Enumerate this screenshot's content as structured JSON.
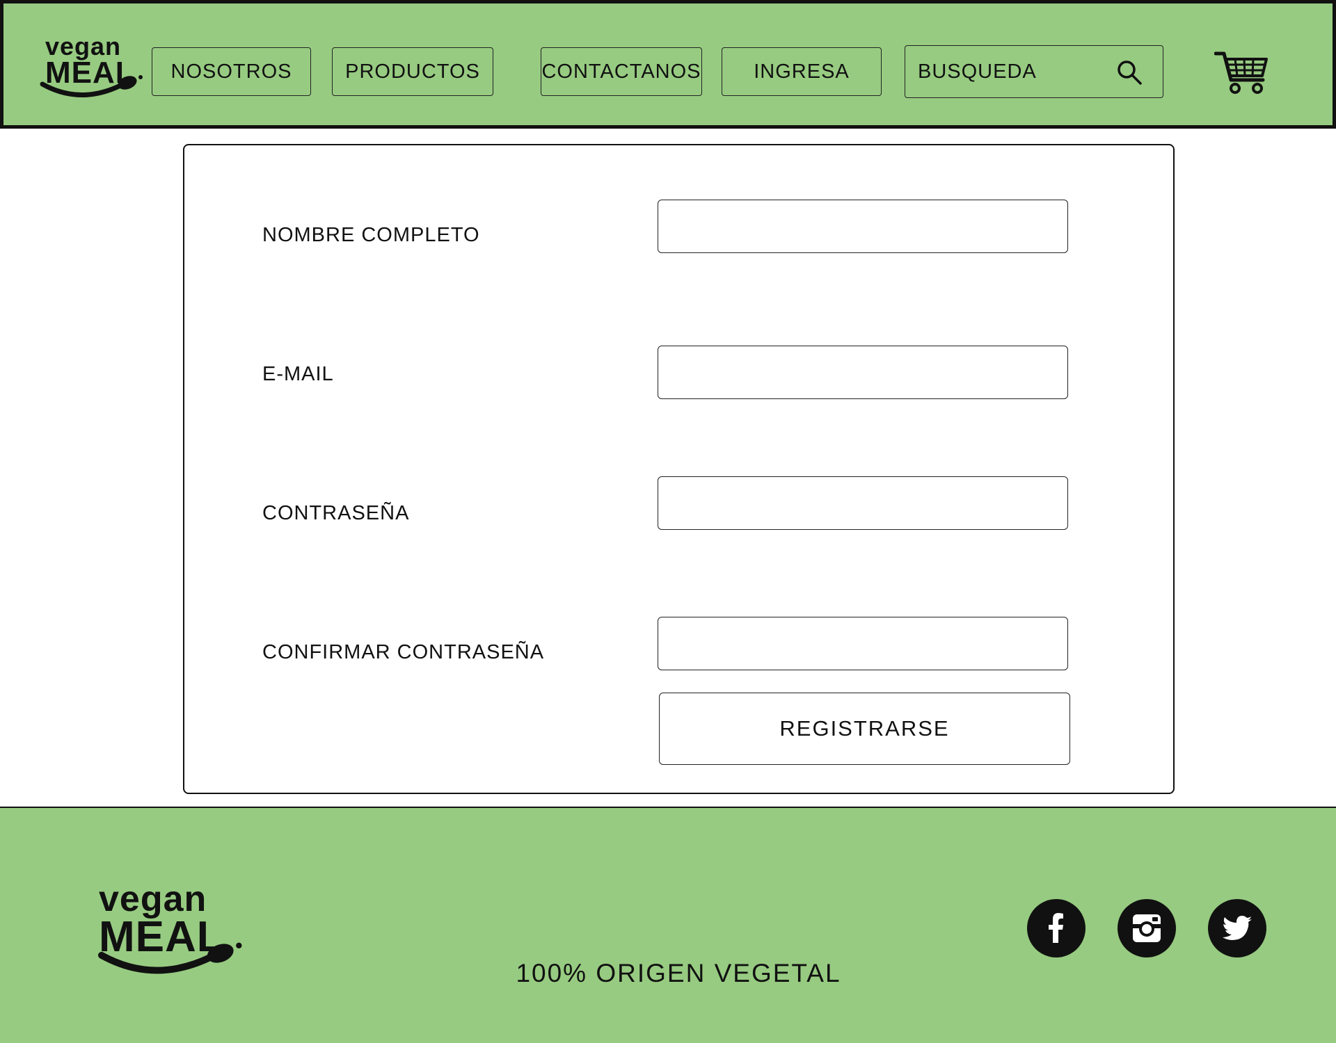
{
  "brand": {
    "logo_top": "vegan",
    "logo_bottom": "MEAL"
  },
  "nav": {
    "items": [
      {
        "label": "NOSOTROS"
      },
      {
        "label": "PRODUCTOS"
      },
      {
        "label": "CONTACTANOS"
      },
      {
        "label": "INGRESA"
      }
    ],
    "search_text": "BUSQUEDA"
  },
  "form": {
    "fields": [
      {
        "label": "NOMBRE COMPLETO",
        "value": ""
      },
      {
        "label": "E-MAIL",
        "value": ""
      },
      {
        "label": "CONTRASEÑA",
        "value": ""
      },
      {
        "label": "CONFIRMAR CONTRASEÑA",
        "value": ""
      }
    ],
    "submit_label": "REGISTRARSE"
  },
  "footer": {
    "tagline": "100% ORIGEN VEGETAL",
    "social": [
      "facebook-icon",
      "instagram-icon",
      "twitter-icon"
    ]
  },
  "colors": {
    "brand_green": "#97cb81",
    "ink": "#111111",
    "background": "#ffffff"
  }
}
